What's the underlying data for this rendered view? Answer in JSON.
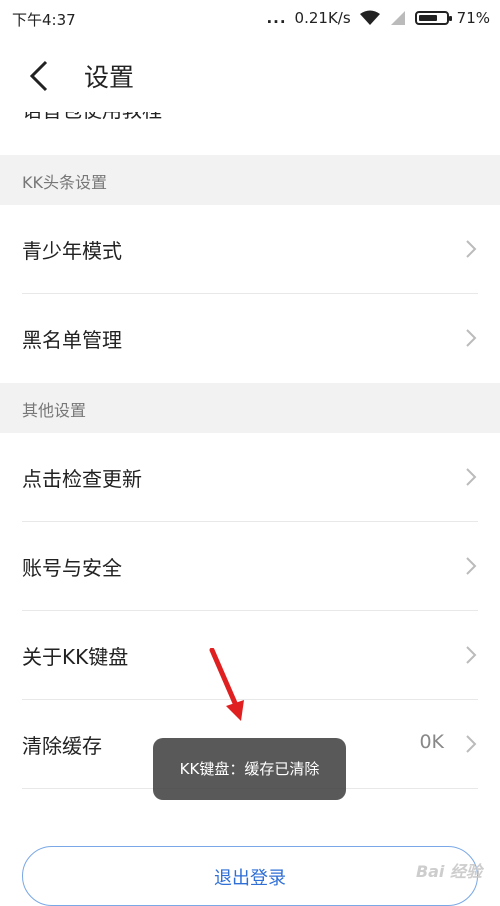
{
  "status_bar": {
    "time": "下午4:37",
    "dots": "...",
    "network_speed": "0.21K/s",
    "battery_text": "71%",
    "battery_level": 0.71
  },
  "header": {
    "title": "设置"
  },
  "partial_item": {
    "label": "语音包使用教程"
  },
  "sections": [
    {
      "title": "KK头条设置",
      "items": [
        {
          "label": "青少年模式"
        },
        {
          "label": "黑名单管理"
        }
      ]
    },
    {
      "title": "其他设置",
      "items": [
        {
          "label": "点击检查更新"
        },
        {
          "label": "账号与安全"
        },
        {
          "label": "关于KK键盘"
        },
        {
          "label": "清除缓存",
          "value": "0K"
        }
      ]
    }
  ],
  "logout": {
    "label": "退出登录"
  },
  "toast": {
    "text": "KK键盘：缓存已清除"
  },
  "colors": {
    "accent": "#2f6fd6",
    "section_bg": "#f2f2f2",
    "arrow": "#e02020"
  },
  "watermark": {
    "text": "Bai 经验"
  }
}
